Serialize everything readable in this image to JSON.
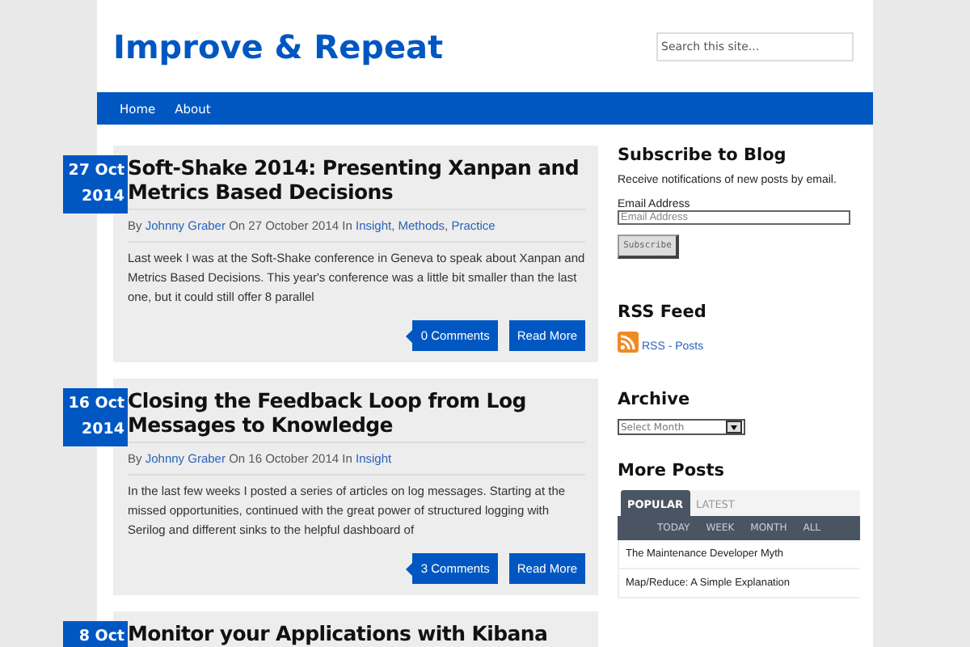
{
  "site": {
    "title": "Improve & Repeat",
    "search": {
      "placeholder": "Search this site..."
    }
  },
  "nav": [
    {
      "label": "Home"
    },
    {
      "label": "About"
    }
  ],
  "posts": [
    {
      "day": "27 Oct",
      "year": "2014",
      "title": "Soft-Shake 2014: Presenting Xanpan and Metrics Based Decisions",
      "by": "By",
      "author": "Johnny Graber",
      "on": "On 27 October 2014 In",
      "categories": [
        "Insight",
        "Methods",
        "Practice"
      ],
      "separator": ",",
      "excerpt": "Last week I was at the Soft-Shake conference in Geneva to speak about Xanpan and Metrics Based Decisions. This year's conference was a little bit smaller than the last one, but it could still offer 8 parallel",
      "comments": "0 Comments",
      "more": "Read More"
    },
    {
      "day": "16 Oct",
      "year": "2014",
      "title": "Closing the Feedback Loop from Log Messages to Knowledge",
      "by": "By",
      "author": "Johnny Graber",
      "on": "On 16 October 2014 In",
      "categories": [
        "Insight"
      ],
      "excerpt": "In the last few weeks I posted a series of articles on log messages. Starting at the missed opportunities, continued with the great power of structured logging with Serilog and different sinks to the helpful dashboard of",
      "comments": "3 Comments",
      "more": "Read More"
    },
    {
      "day": "8 Oct",
      "title": "Monitor your Applications with Kibana"
    }
  ],
  "sidebar": {
    "subscribe": {
      "heading": "Subscribe to Blog",
      "text": "Receive notifications of new posts by email.",
      "label": "Email Address",
      "placeholder": "Email Address",
      "button": "Subscribe"
    },
    "rss": {
      "heading": "RSS Feed",
      "link": "RSS - Posts"
    },
    "archive": {
      "heading": "Archive",
      "select": "Select Month"
    },
    "more": {
      "heading": "More Posts",
      "tabs": [
        {
          "label": "POPULAR",
          "selected": true
        },
        {
          "label": "LATEST",
          "selected": false
        }
      ],
      "periods": [
        "TODAY",
        "WEEK",
        "MONTH",
        "ALL"
      ],
      "items": [
        "The Maintenance Developer Myth",
        "Map/Reduce: A Simple Explanation"
      ]
    }
  }
}
